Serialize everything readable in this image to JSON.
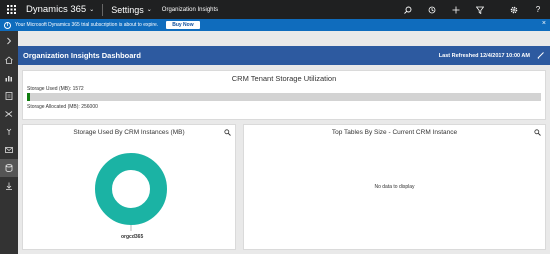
{
  "topbar": {
    "app_title": "Dynamics 365",
    "area": "Settings",
    "page": "Organization Insights",
    "icons": [
      "waffle-icon",
      "search-icon",
      "history-icon",
      "add-icon",
      "filter-icon",
      "gear-icon",
      "help-icon"
    ]
  },
  "notice": {
    "message": "Your Microsoft Dynamics 365 trial subscription is about to expire.",
    "button_label": "Buy Now"
  },
  "leftnav": {
    "icons": [
      "chevron-right-icon",
      "home-icon",
      "chart-icon",
      "document-icon",
      "shuffle-icon",
      "plug-icon",
      "mail-icon",
      "database-icon",
      "download-icon"
    ]
  },
  "header": {
    "title": "Organization Insights Dashboard",
    "refresh": "Last Refreshed  12/4/2017 10:00 AM"
  },
  "storage": {
    "title": "CRM Tenant Storage Utilization",
    "used_label": "Storage Used (MB): 1572",
    "allocated_label": "Storage Allocated (MB): 256000",
    "used_fraction": 0.006,
    "bar_color": "#107c10"
  },
  "instances": {
    "title": "Storage Used By CRM Instances (MB)"
  },
  "tables": {
    "title": "Top Tables By Size - Current CRM Instance",
    "empty_text": "No data to display"
  },
  "chart_data": {
    "type": "pie",
    "categories": [
      "orgcd365"
    ],
    "values": [
      1572
    ],
    "colors": [
      "#1bb3a4"
    ]
  }
}
